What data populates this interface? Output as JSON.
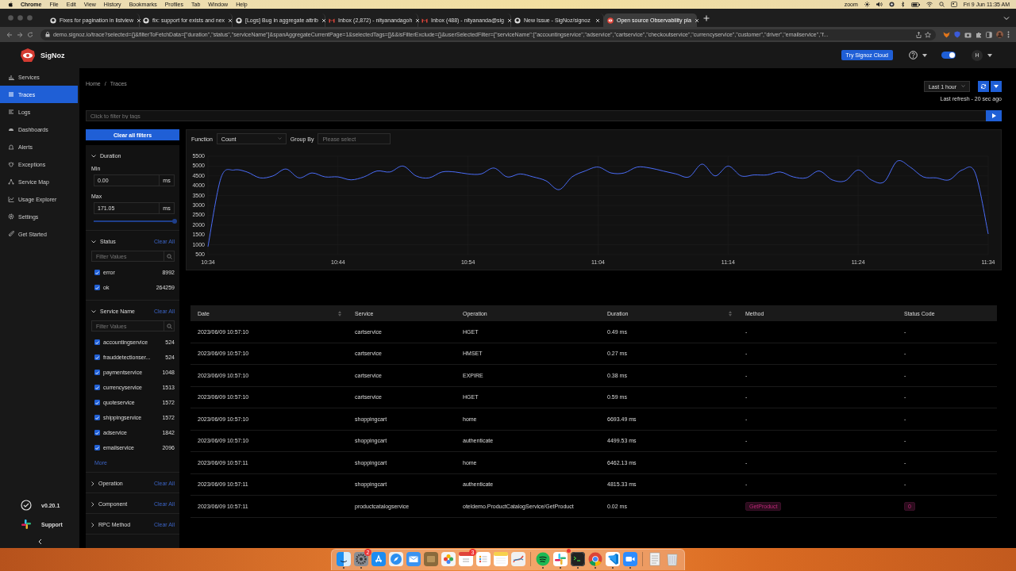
{
  "menubar": {
    "app": "Chrome",
    "menus": [
      "File",
      "Edit",
      "View",
      "History",
      "Bookmarks",
      "Profiles",
      "Tab",
      "Window",
      "Help"
    ],
    "status_text": "zoom",
    "clock": "Fri 9 Jun 11:35 AM"
  },
  "browser": {
    "tabs": [
      {
        "title": "Fixes for pagination in listview",
        "selected": false
      },
      {
        "title": "fix: support for exists and nex",
        "selected": false
      },
      {
        "title": "[Logs] Bug in aggregate attrib",
        "selected": false
      },
      {
        "title": "Inbox (2,872) - nityanandagoh",
        "selected": false
      },
      {
        "title": "Inbox (488) - nityananda@sig",
        "selected": false
      },
      {
        "title": "New Issue - SigNoz/signoz",
        "selected": false
      },
      {
        "title": "Open source Observability pla",
        "selected": true
      }
    ],
    "url": "demo.signoz.io/trace?selected={}&filterToFetchData=[\"duration\",\"status\",\"serviceName\"]&spanAggregateCurrentPage=1&selectedTags=[]&&isFilterExclude={}&userSelectedFilter={\"serviceName\":[\"accountingservice\",\"adservice\",\"cartservice\",\"checkoutservice\",\"currencyservice\",\"customer\",\"driver\",\"emailservice\",\"f..."
  },
  "app": {
    "logo": "SigNoz",
    "cloud_button": "Try Signoz Cloud",
    "theme_toggle": {
      "on": true
    },
    "avatar": "H"
  },
  "sidebar": {
    "items": [
      {
        "label": "Services",
        "selected": false
      },
      {
        "label": "Traces",
        "selected": true
      },
      {
        "label": "Logs",
        "selected": false
      },
      {
        "label": "Dashboards",
        "selected": false
      },
      {
        "label": "Alerts",
        "selected": false
      },
      {
        "label": "Exceptions",
        "selected": false
      },
      {
        "label": "Service Map",
        "selected": false
      },
      {
        "label": "Usage Explorer",
        "selected": false
      },
      {
        "label": "Settings",
        "selected": false
      },
      {
        "label": "Get Started",
        "selected": false
      }
    ],
    "version": "v0.20.1",
    "support": "Support"
  },
  "breadcrumb": {
    "items": [
      "Home",
      "Traces"
    ],
    "separator": "/"
  },
  "time_range": {
    "value": "Last 1 hour",
    "last_refresh": "Last refresh - 20 sec ago"
  },
  "tag_filter": {
    "placeholder": "Click to filter by tags"
  },
  "filters": {
    "clear_all": "Clear all filters",
    "sections": [
      {
        "kind": "duration",
        "title": "Duration",
        "expanded": true,
        "min_label": "Min",
        "min": "0.00",
        "min_unit": "ms",
        "max_label": "Max",
        "max": "171.05",
        "max_unit": "ms",
        "slider": {
          "level": 1
        }
      },
      {
        "kind": "list",
        "title": "Status",
        "expanded": true,
        "clear": "Clear All",
        "placeholder": "Filter Values",
        "items": [
          {
            "label": "error",
            "count": "8992",
            "checked": true
          },
          {
            "label": "ok",
            "count": "264259",
            "checked": true
          }
        ]
      },
      {
        "kind": "list",
        "title": "Service Name",
        "expanded": true,
        "clear": "Clear All",
        "placeholder": "Filter Values",
        "more": "More",
        "items": [
          {
            "label": "accountingservice",
            "count": "524",
            "checked": true
          },
          {
            "label": "frauddetectionser...",
            "count": "524",
            "checked": true
          },
          {
            "label": "paymentservice",
            "count": "1048",
            "checked": true
          },
          {
            "label": "currencyservice",
            "count": "1513",
            "checked": true
          },
          {
            "label": "quoteservice",
            "count": "1572",
            "checked": true
          },
          {
            "label": "shippingservice",
            "count": "1572",
            "checked": true
          },
          {
            "label": "adservice",
            "count": "1842",
            "checked": true
          },
          {
            "label": "emailservice",
            "count": "2096",
            "checked": true
          }
        ]
      },
      {
        "title": "Operation",
        "expanded": false,
        "clear": "Clear All"
      },
      {
        "title": "Component",
        "expanded": false,
        "clear": "Clear All"
      },
      {
        "title": "RPC Method",
        "expanded": false,
        "clear": "Clear All"
      }
    ]
  },
  "query": {
    "function_label": "Function",
    "function": "Count",
    "group_by_label": "Group By",
    "group_by_placeholder": "Please select",
    "chart_data": {
      "type": "line",
      "grid": true,
      "categories": [
        "10:34",
        null,
        null,
        null,
        null,
        null,
        null,
        null,
        null,
        null,
        "10:44",
        null,
        null,
        null,
        null,
        null,
        null,
        null,
        null,
        null,
        "10:54",
        null,
        null,
        null,
        null,
        null,
        null,
        null,
        null,
        null,
        "11:04",
        null,
        null,
        null,
        null,
        null,
        null,
        null,
        null,
        null,
        "11:14",
        null,
        null,
        null,
        null,
        null,
        null,
        null,
        null,
        null,
        "11:24",
        null,
        null,
        null,
        null,
        null,
        null,
        null,
        null,
        null,
        "11:34"
      ],
      "ylim": [
        500,
        5500
      ],
      "yticks": [
        500,
        1000,
        1500,
        2000,
        2500,
        3000,
        3500,
        4000,
        4500,
        5000,
        5500
      ],
      "series": [
        {
          "color": "#4a6cf7",
          "values": [
            900,
            4400,
            4800,
            4700,
            4400,
            4500,
            4850,
            4400,
            4650,
            4450,
            4450,
            4300,
            4450,
            4750,
            4700,
            5000,
            4500,
            4400,
            4700,
            4700,
            4600,
            4600,
            4900,
            4450,
            4600,
            4450,
            4250,
            3800,
            4450,
            4750,
            4950,
            4650,
            4650,
            4950,
            4900,
            4750,
            4600,
            4450,
            5100,
            4500,
            5000,
            4500,
            4550,
            4550,
            4700,
            4450,
            4400,
            4750,
            4300,
            4250,
            4800,
            4300,
            4200,
            5250,
            4950,
            4450,
            4400,
            4300,
            4800,
            4650,
            1550
          ]
        }
      ]
    }
  },
  "table": {
    "columns": [
      {
        "label": "Date",
        "sortable": true
      },
      {
        "label": "Service",
        "sortable": false
      },
      {
        "label": "Operation",
        "sortable": false
      },
      {
        "label": "Duration",
        "sortable": true
      },
      {
        "label": "Method",
        "sortable": false
      },
      {
        "label": "Status Code",
        "sortable": false
      }
    ],
    "rows": [
      {
        "kind": "plain",
        "date": "2023/06/09 10:57:10",
        "service": "cartservice",
        "operation": "HGET",
        "duration": "0.49 ms",
        "method": "-",
        "status_code": "-"
      },
      {
        "kind": "plain",
        "date": "2023/06/09 10:57:10",
        "service": "cartservice",
        "operation": "HMSET",
        "duration": "0.27 ms",
        "method": "-",
        "status_code": "-"
      },
      {
        "kind": "plain",
        "date": "2023/06/09 10:57:10",
        "service": "cartservice",
        "operation": "EXPIRE",
        "duration": "0.38 ms",
        "method": "-",
        "status_code": "-"
      },
      {
        "kind": "plain",
        "date": "2023/06/09 10:57:10",
        "service": "cartservice",
        "operation": "HGET",
        "duration": "0.59 ms",
        "method": "-",
        "status_code": "-"
      },
      {
        "kind": "plain",
        "date": "2023/06/09 10:57:10",
        "service": "shoppingcart",
        "operation": "home",
        "duration": "6693.49 ms",
        "method": "-",
        "status_code": "-"
      },
      {
        "kind": "plain",
        "date": "2023/06/09 10:57:10",
        "service": "shoppingcart",
        "operation": "authenticate",
        "duration": "4499.53 ms",
        "method": "-",
        "status_code": "-"
      },
      {
        "kind": "plain",
        "date": "2023/06/09 10:57:11",
        "service": "shoppingcart",
        "operation": "home",
        "duration": "6462.13 ms",
        "method": "-",
        "status_code": "-"
      },
      {
        "kind": "plain",
        "date": "2023/06/09 10:57:11",
        "service": "shoppingcart",
        "operation": "authenticate",
        "duration": "4815.33 ms",
        "method": "-",
        "status_code": "-"
      },
      {
        "kind": "rpc",
        "date": "2023/06/09 10:57:11",
        "service": "productcatalogservice",
        "operation": "oteldemo.ProductCatalogService/GetProduct",
        "duration": "0.02 ms",
        "method": "GetProduct",
        "status_code": "0"
      }
    ]
  },
  "dock": {
    "items": [
      {
        "running": true
      },
      {
        "running": true,
        "badge": "2"
      },
      {
        "running": false
      },
      {
        "running": false
      },
      {
        "running": false
      },
      {
        "running": false
      },
      {
        "running": false
      },
      {
        "running": false,
        "badge": "3"
      },
      {
        "running": false
      },
      {
        "running": false
      },
      {
        "running": false
      },
      {
        "running": true
      },
      {
        "running": true,
        "alert": true
      },
      {
        "running": true
      },
      {
        "running": true
      },
      {
        "running": true
      },
      {
        "running": true
      },
      {
        "running": false
      },
      {
        "running": false
      }
    ]
  }
}
